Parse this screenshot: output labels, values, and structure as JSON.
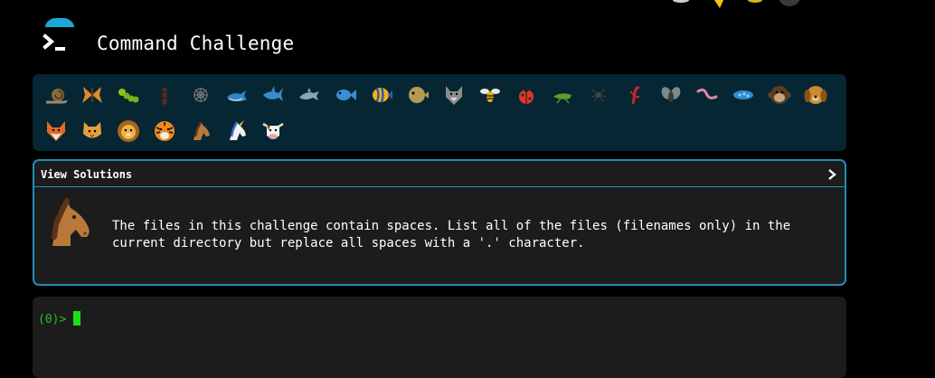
{
  "header": {
    "title": "Command Challenge",
    "logo_icon": "terminal-prompt-icon",
    "logo_bg": "#1aa7d9"
  },
  "challenges": {
    "items": [
      {
        "icon": "snail-icon"
      },
      {
        "icon": "butterfly-icon"
      },
      {
        "icon": "caterpillar-icon"
      },
      {
        "icon": "ant-icon"
      },
      {
        "icon": "spider-web-icon"
      },
      {
        "icon": "whale-icon"
      },
      {
        "icon": "shark-icon"
      },
      {
        "icon": "dolphin-icon"
      },
      {
        "icon": "fish-icon"
      },
      {
        "icon": "tropical-fish-icon"
      },
      {
        "icon": "blowfish-icon"
      },
      {
        "icon": "wolf-icon"
      },
      {
        "icon": "bee-icon"
      },
      {
        "icon": "ladybug-icon"
      },
      {
        "icon": "cricket-icon"
      },
      {
        "icon": "spider-icon"
      },
      {
        "icon": "scorpion-icon"
      },
      {
        "icon": "fly-icon"
      },
      {
        "icon": "worm-icon"
      },
      {
        "icon": "microbe-icon"
      },
      {
        "icon": "monkey-icon"
      },
      {
        "icon": "dog-icon"
      },
      {
        "icon": "fox-icon"
      },
      {
        "icon": "cat-icon"
      },
      {
        "icon": "lion-icon"
      },
      {
        "icon": "tiger-icon"
      },
      {
        "icon": "horse-icon"
      },
      {
        "icon": "unicorn-icon"
      },
      {
        "icon": "cow-icon"
      }
    ]
  },
  "solution_panel": {
    "header_label": "View Solutions",
    "avatar_icon": "horse-icon",
    "description": "The files in this challenge contain spaces. List all of the files (filenames only) in the current directory but replace all spaces with a '.' character."
  },
  "terminal": {
    "prompt": "(0)>"
  },
  "colors": {
    "accent": "#1f8fb7",
    "challenge_bar_bg": "#062634",
    "panel_bg": "#1c1c1c",
    "prompt_green": "#25c225",
    "cursor_green": "#18e018"
  }
}
